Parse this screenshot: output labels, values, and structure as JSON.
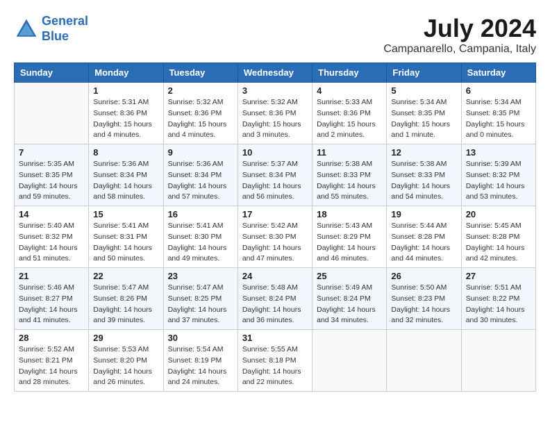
{
  "header": {
    "logo_line1": "General",
    "logo_line2": "Blue",
    "month_year": "July 2024",
    "location": "Campanarello, Campania, Italy"
  },
  "columns": [
    "Sunday",
    "Monday",
    "Tuesday",
    "Wednesday",
    "Thursday",
    "Friday",
    "Saturday"
  ],
  "weeks": [
    [
      {
        "day": "",
        "info": ""
      },
      {
        "day": "1",
        "info": "Sunrise: 5:31 AM\nSunset: 8:36 PM\nDaylight: 15 hours\nand 4 minutes."
      },
      {
        "day": "2",
        "info": "Sunrise: 5:32 AM\nSunset: 8:36 PM\nDaylight: 15 hours\nand 4 minutes."
      },
      {
        "day": "3",
        "info": "Sunrise: 5:32 AM\nSunset: 8:36 PM\nDaylight: 15 hours\nand 3 minutes."
      },
      {
        "day": "4",
        "info": "Sunrise: 5:33 AM\nSunset: 8:36 PM\nDaylight: 15 hours\nand 2 minutes."
      },
      {
        "day": "5",
        "info": "Sunrise: 5:34 AM\nSunset: 8:35 PM\nDaylight: 15 hours\nand 1 minute."
      },
      {
        "day": "6",
        "info": "Sunrise: 5:34 AM\nSunset: 8:35 PM\nDaylight: 15 hours\nand 0 minutes."
      }
    ],
    [
      {
        "day": "7",
        "info": "Sunrise: 5:35 AM\nSunset: 8:35 PM\nDaylight: 14 hours\nand 59 minutes."
      },
      {
        "day": "8",
        "info": "Sunrise: 5:36 AM\nSunset: 8:34 PM\nDaylight: 14 hours\nand 58 minutes."
      },
      {
        "day": "9",
        "info": "Sunrise: 5:36 AM\nSunset: 8:34 PM\nDaylight: 14 hours\nand 57 minutes."
      },
      {
        "day": "10",
        "info": "Sunrise: 5:37 AM\nSunset: 8:34 PM\nDaylight: 14 hours\nand 56 minutes."
      },
      {
        "day": "11",
        "info": "Sunrise: 5:38 AM\nSunset: 8:33 PM\nDaylight: 14 hours\nand 55 minutes."
      },
      {
        "day": "12",
        "info": "Sunrise: 5:38 AM\nSunset: 8:33 PM\nDaylight: 14 hours\nand 54 minutes."
      },
      {
        "day": "13",
        "info": "Sunrise: 5:39 AM\nSunset: 8:32 PM\nDaylight: 14 hours\nand 53 minutes."
      }
    ],
    [
      {
        "day": "14",
        "info": "Sunrise: 5:40 AM\nSunset: 8:32 PM\nDaylight: 14 hours\nand 51 minutes."
      },
      {
        "day": "15",
        "info": "Sunrise: 5:41 AM\nSunset: 8:31 PM\nDaylight: 14 hours\nand 50 minutes."
      },
      {
        "day": "16",
        "info": "Sunrise: 5:41 AM\nSunset: 8:30 PM\nDaylight: 14 hours\nand 49 minutes."
      },
      {
        "day": "17",
        "info": "Sunrise: 5:42 AM\nSunset: 8:30 PM\nDaylight: 14 hours\nand 47 minutes."
      },
      {
        "day": "18",
        "info": "Sunrise: 5:43 AM\nSunset: 8:29 PM\nDaylight: 14 hours\nand 46 minutes."
      },
      {
        "day": "19",
        "info": "Sunrise: 5:44 AM\nSunset: 8:28 PM\nDaylight: 14 hours\nand 44 minutes."
      },
      {
        "day": "20",
        "info": "Sunrise: 5:45 AM\nSunset: 8:28 PM\nDaylight: 14 hours\nand 42 minutes."
      }
    ],
    [
      {
        "day": "21",
        "info": "Sunrise: 5:46 AM\nSunset: 8:27 PM\nDaylight: 14 hours\nand 41 minutes."
      },
      {
        "day": "22",
        "info": "Sunrise: 5:47 AM\nSunset: 8:26 PM\nDaylight: 14 hours\nand 39 minutes."
      },
      {
        "day": "23",
        "info": "Sunrise: 5:47 AM\nSunset: 8:25 PM\nDaylight: 14 hours\nand 37 minutes."
      },
      {
        "day": "24",
        "info": "Sunrise: 5:48 AM\nSunset: 8:24 PM\nDaylight: 14 hours\nand 36 minutes."
      },
      {
        "day": "25",
        "info": "Sunrise: 5:49 AM\nSunset: 8:24 PM\nDaylight: 14 hours\nand 34 minutes."
      },
      {
        "day": "26",
        "info": "Sunrise: 5:50 AM\nSunset: 8:23 PM\nDaylight: 14 hours\nand 32 minutes."
      },
      {
        "day": "27",
        "info": "Sunrise: 5:51 AM\nSunset: 8:22 PM\nDaylight: 14 hours\nand 30 minutes."
      }
    ],
    [
      {
        "day": "28",
        "info": "Sunrise: 5:52 AM\nSunset: 8:21 PM\nDaylight: 14 hours\nand 28 minutes."
      },
      {
        "day": "29",
        "info": "Sunrise: 5:53 AM\nSunset: 8:20 PM\nDaylight: 14 hours\nand 26 minutes."
      },
      {
        "day": "30",
        "info": "Sunrise: 5:54 AM\nSunset: 8:19 PM\nDaylight: 14 hours\nand 24 minutes."
      },
      {
        "day": "31",
        "info": "Sunrise: 5:55 AM\nSunset: 8:18 PM\nDaylight: 14 hours\nand 22 minutes."
      },
      {
        "day": "",
        "info": ""
      },
      {
        "day": "",
        "info": ""
      },
      {
        "day": "",
        "info": ""
      }
    ]
  ]
}
